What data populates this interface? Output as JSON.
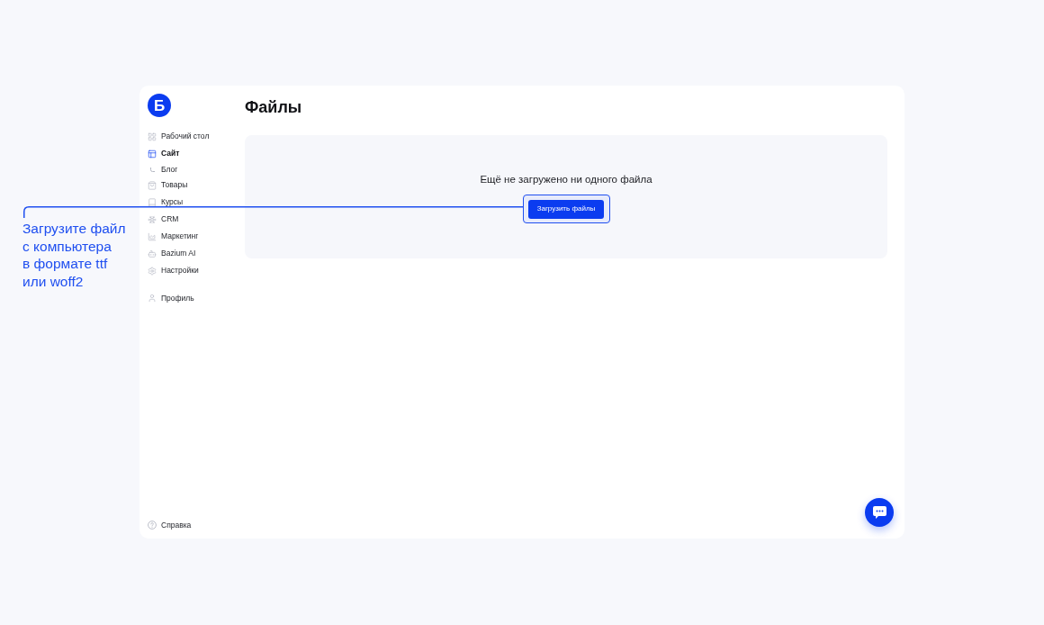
{
  "sidebar": {
    "logo": {
      "letter": "Б"
    },
    "items": [
      {
        "label": "Рабочий стол",
        "selected": false
      },
      {
        "label": "Сайт",
        "selected": true,
        "children": [
          {
            "label": "Блог",
            "selected": false
          }
        ]
      },
      {
        "label": "Товары",
        "selected": false
      },
      {
        "label": "Курсы",
        "selected": false
      },
      {
        "label": "CRM",
        "selected": false
      },
      {
        "label": "Маркетинг",
        "selected": false
      },
      {
        "label": "Bazium AI",
        "selected": false
      },
      {
        "label": "Настройки",
        "selected": false
      }
    ],
    "profile": {
      "label": "Профиль"
    },
    "help": {
      "label": "Справка"
    }
  },
  "page": {
    "title": "Файлы"
  },
  "empty_state": {
    "message": "Ещё не загружено ни одного файла",
    "button": "Загрузить файлы"
  },
  "callout": {
    "text": "Загрузите файл\nс компьютера\nв формате ttf\nили woff2"
  }
}
